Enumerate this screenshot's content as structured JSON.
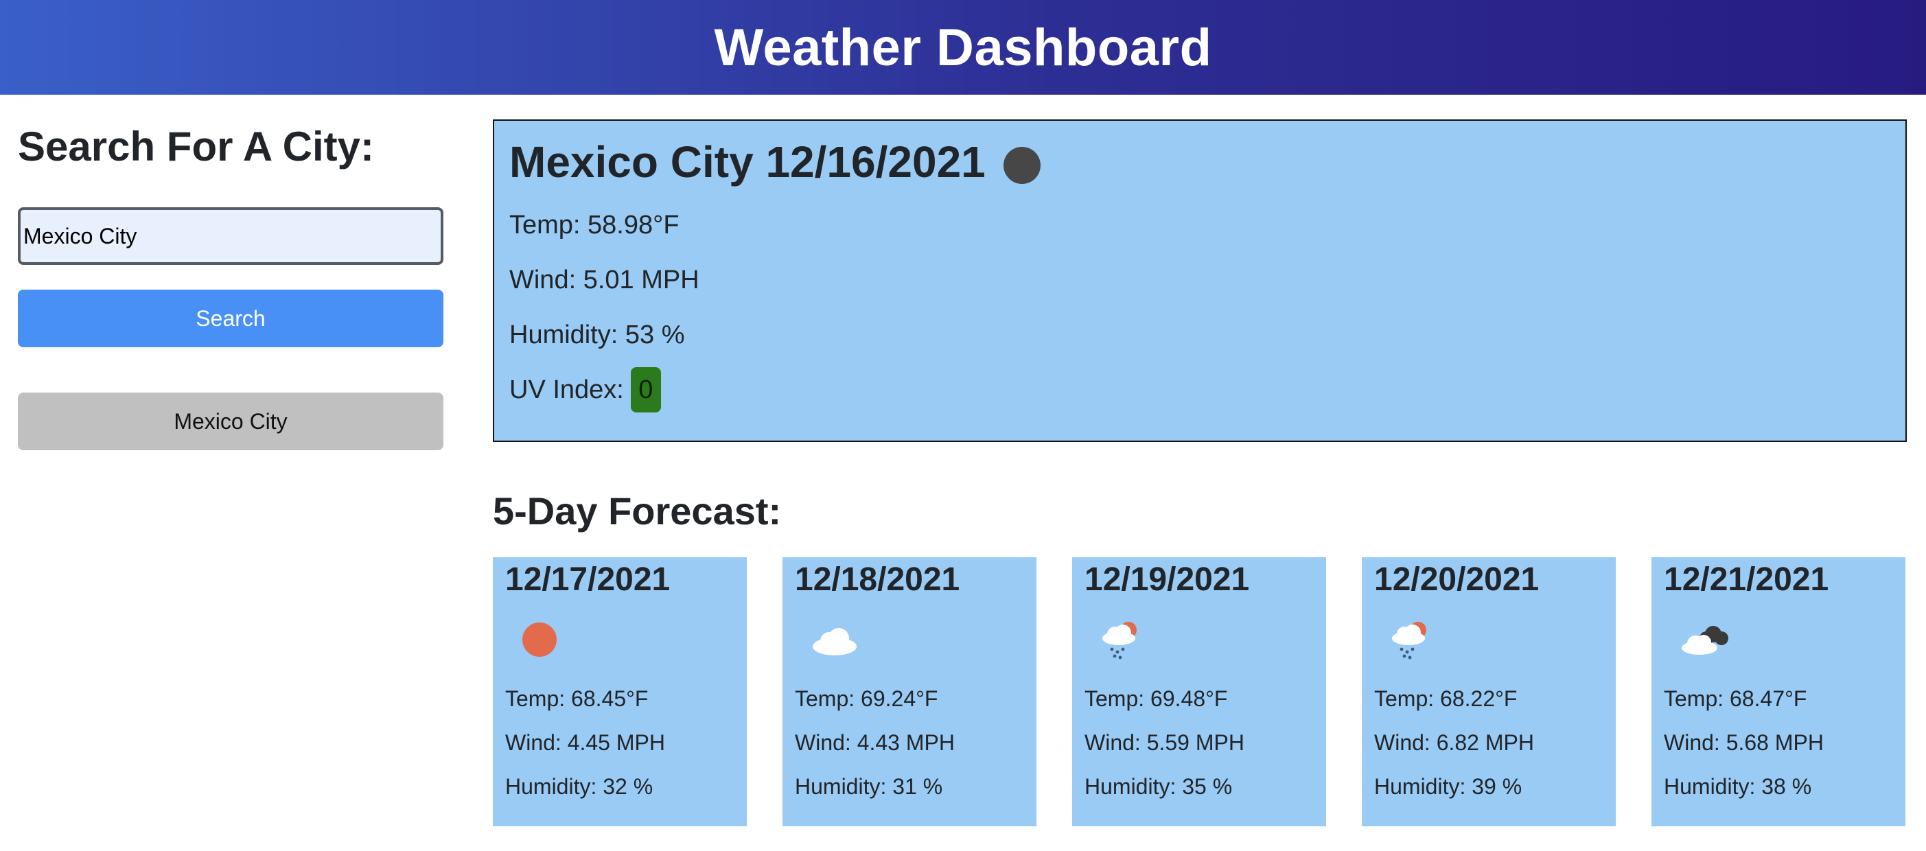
{
  "header": {
    "title": "Weather Dashboard"
  },
  "sidebar": {
    "heading": "Search For A City:",
    "search_value": "Mexico City",
    "search_button": "Search",
    "history": [
      "Mexico City"
    ]
  },
  "current": {
    "title": "Mexico City 12/16/2021",
    "icon": "moon-icon",
    "temp": "Temp: 58.98°F",
    "wind": "Wind: 5.01 MPH",
    "humidity": "Humidity: 53 %",
    "uv_label": "UV Index:",
    "uv_value": "0",
    "uv_color": "#2b7b1c"
  },
  "forecast": {
    "title": "5-Day Forecast:",
    "days": [
      {
        "date": "12/17/2021",
        "icon": "sun-icon",
        "temp": "Temp: 68.45°F",
        "wind": "Wind: 4.45 MPH",
        "humidity": "Humidity: 32 %"
      },
      {
        "date": "12/18/2021",
        "icon": "cloud-icon",
        "temp": "Temp: 69.24°F",
        "wind": "Wind: 4.43 MPH",
        "humidity": "Humidity: 31 %"
      },
      {
        "date": "12/19/2021",
        "icon": "rain-cloud-icon",
        "temp": "Temp: 69.48°F",
        "wind": "Wind: 5.59 MPH",
        "humidity": "Humidity: 35 %"
      },
      {
        "date": "12/20/2021",
        "icon": "rain-cloud-icon",
        "temp": "Temp: 68.22°F",
        "wind": "Wind: 6.82 MPH",
        "humidity": "Humidity: 39 %"
      },
      {
        "date": "12/21/2021",
        "icon": "dark-cloud-icon",
        "temp": "Temp: 68.47°F",
        "wind": "Wind: 5.68 MPH",
        "humidity": "Humidity: 38 %"
      }
    ]
  },
  "colors": {
    "accent": "#4890f6",
    "card_bg": "#99cbf4",
    "history_bg": "#c0c0c0"
  }
}
